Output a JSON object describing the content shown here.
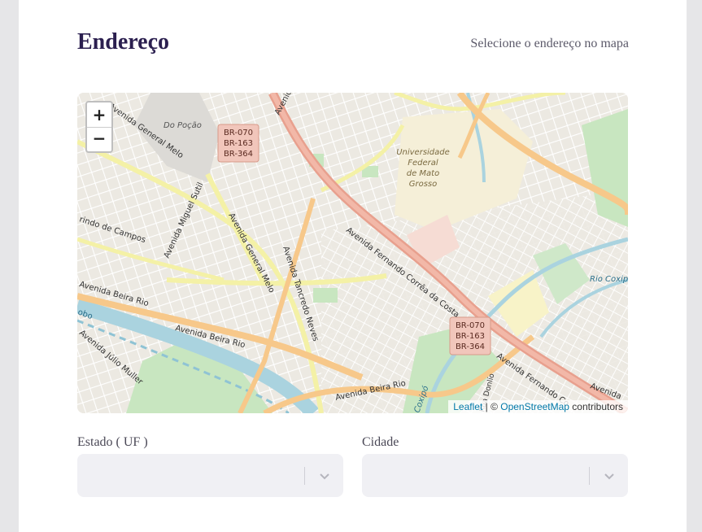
{
  "header": {
    "title": "Endereço",
    "hint": "Selecione o endereço no mapa"
  },
  "map": {
    "zoom_in": "+",
    "zoom_out": "−",
    "attribution": {
      "leaflet": "Leaflet",
      "separator": " | © ",
      "osm": "OpenStreetMap",
      "suffix": " contributors"
    },
    "labels": {
      "do_pocao": "Do Poção",
      "av_general_melo_top": "Avenida General Melo",
      "av_miguel_sutil": "Avenida Miguel Sutil",
      "av_general_melo_mid": "Avenida General Melo",
      "av_tancredo_neves": "Avenida Tancredo Neves",
      "av_fernando_correa": "Avenida Fernando Corrêa da Costa",
      "av_fernando_right": "Avenida Fernando Co",
      "av_beira_rio_left": "Avenida Beira Rio",
      "av_beira_rio_mid": "Avenida Beira Rio",
      "av_beira_rio_bottom": "Avenida Beira Rio",
      "av_julio_muller": "Avenida Júlio Muller",
      "rindo_de_campos": "rindo de Campos",
      "rio_coxipo": "Rio Coxipó",
      "coxipo": "Coxipó",
      "av_partial_top": "Avenida",
      "av_partial_right": "Avenida",
      "ufmt_1": "Universidade",
      "ufmt_2": "Federal",
      "ufmt_3": "de Mato",
      "ufmt_4": "Grosso",
      "rua_donlio": "Rua Donlío",
      "robo": "obo",
      "br_shield_1": [
        "BR-070",
        "BR-163",
        "BR-364"
      ],
      "br_shield_2": [
        "BR-070",
        "BR-163",
        "BR-364"
      ]
    }
  },
  "form": {
    "estado_label": "Estado ( UF )",
    "cidade_label": "Cidade"
  },
  "colors": {
    "title": "#2b1f4f",
    "select_bg": "#f0f0f4",
    "highway": "#e8a08e",
    "primary_road": "#f7c88a",
    "secondary_road": "#f4f1a6",
    "river": "#aad3df",
    "park": "#c8e6c0"
  }
}
